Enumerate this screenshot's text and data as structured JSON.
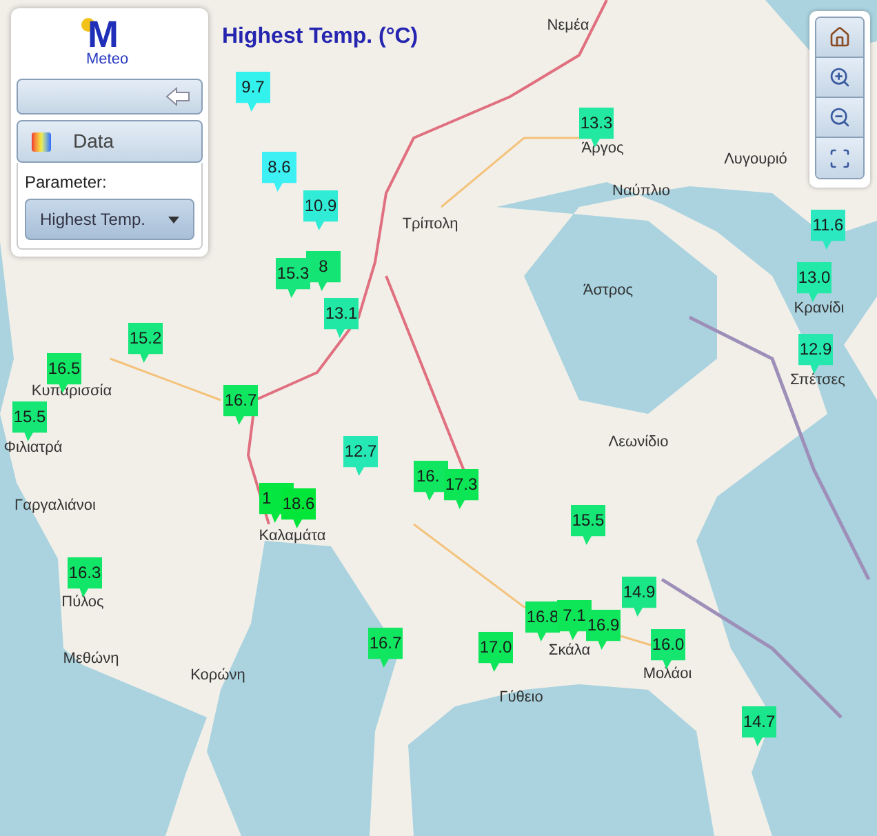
{
  "logo": {
    "mark": "M",
    "name": "Meteo"
  },
  "panel": {
    "data_button": {
      "label": "Data"
    },
    "parameter_label": "Parameter:",
    "parameter_select": {
      "value": "Highest Temp."
    }
  },
  "title": "Highest Temp. (°C)",
  "place_labels": [
    "Νεμέα",
    "Άργος",
    "Ναύπλιο",
    "Λυγουριό",
    "Τρίπολη",
    "Άστρος",
    "Κρανίδι",
    "Σπέτσες",
    "Κυπαρισσία",
    "Φιλιατρά",
    "Γαργαλιάνοι",
    "Καλαμάτα",
    "Λεωνίδιο",
    "Σκάλα",
    "Μολάοι",
    "Γύθειο",
    "Πύλος",
    "Μεθώνη",
    "Κορώνη"
  ],
  "markers": [
    {
      "value": "9.7",
      "color": "#33f2ee"
    },
    {
      "value": "8.6",
      "color": "#3cf0f4"
    },
    {
      "value": "10.9",
      "color": "#30ecd6"
    },
    {
      "value": "8",
      "color": "#14e474"
    },
    {
      "value": "15.3",
      "color": "#18e67c"
    },
    {
      "value": "13.1",
      "color": "#22e8a6"
    },
    {
      "value": "13.3",
      "color": "#22e8a2"
    },
    {
      "value": "11.6",
      "color": "#2ce8c0"
    },
    {
      "value": "13.0",
      "color": "#22e8a8"
    },
    {
      "value": "12.9",
      "color": "#24e8ae"
    },
    {
      "value": "15.2",
      "color": "#18e67e"
    },
    {
      "value": "16.5",
      "color": "#12e664"
    },
    {
      "value": "15.5",
      "color": "#16e676"
    },
    {
      "value": "16.7",
      "color": "#10e660"
    },
    {
      "value": "12.7",
      "color": "#26e8b4"
    },
    {
      "value": "16.",
      "color": "#10e660"
    },
    {
      "value": "17.3",
      "color": "#0ce654"
    },
    {
      "value": "1",
      "color": "#06e640"
    },
    {
      "value": "18.6",
      "color": "#02e63a"
    },
    {
      "value": "15.5",
      "color": "#16e676"
    },
    {
      "value": "16.3",
      "color": "#12e668"
    },
    {
      "value": "14.9",
      "color": "#1ae688"
    },
    {
      "value": "16.7",
      "color": "#10e660"
    },
    {
      "value": "17.0",
      "color": "#0ee65a"
    },
    {
      "value": "16.8",
      "color": "#10e65e"
    },
    {
      "value": "7.1",
      "color": "#0ee658"
    },
    {
      "value": "16.9",
      "color": "#10e65c"
    },
    {
      "value": "16.0",
      "color": "#14e670"
    },
    {
      "value": "14.7",
      "color": "#1ae68c"
    }
  ]
}
